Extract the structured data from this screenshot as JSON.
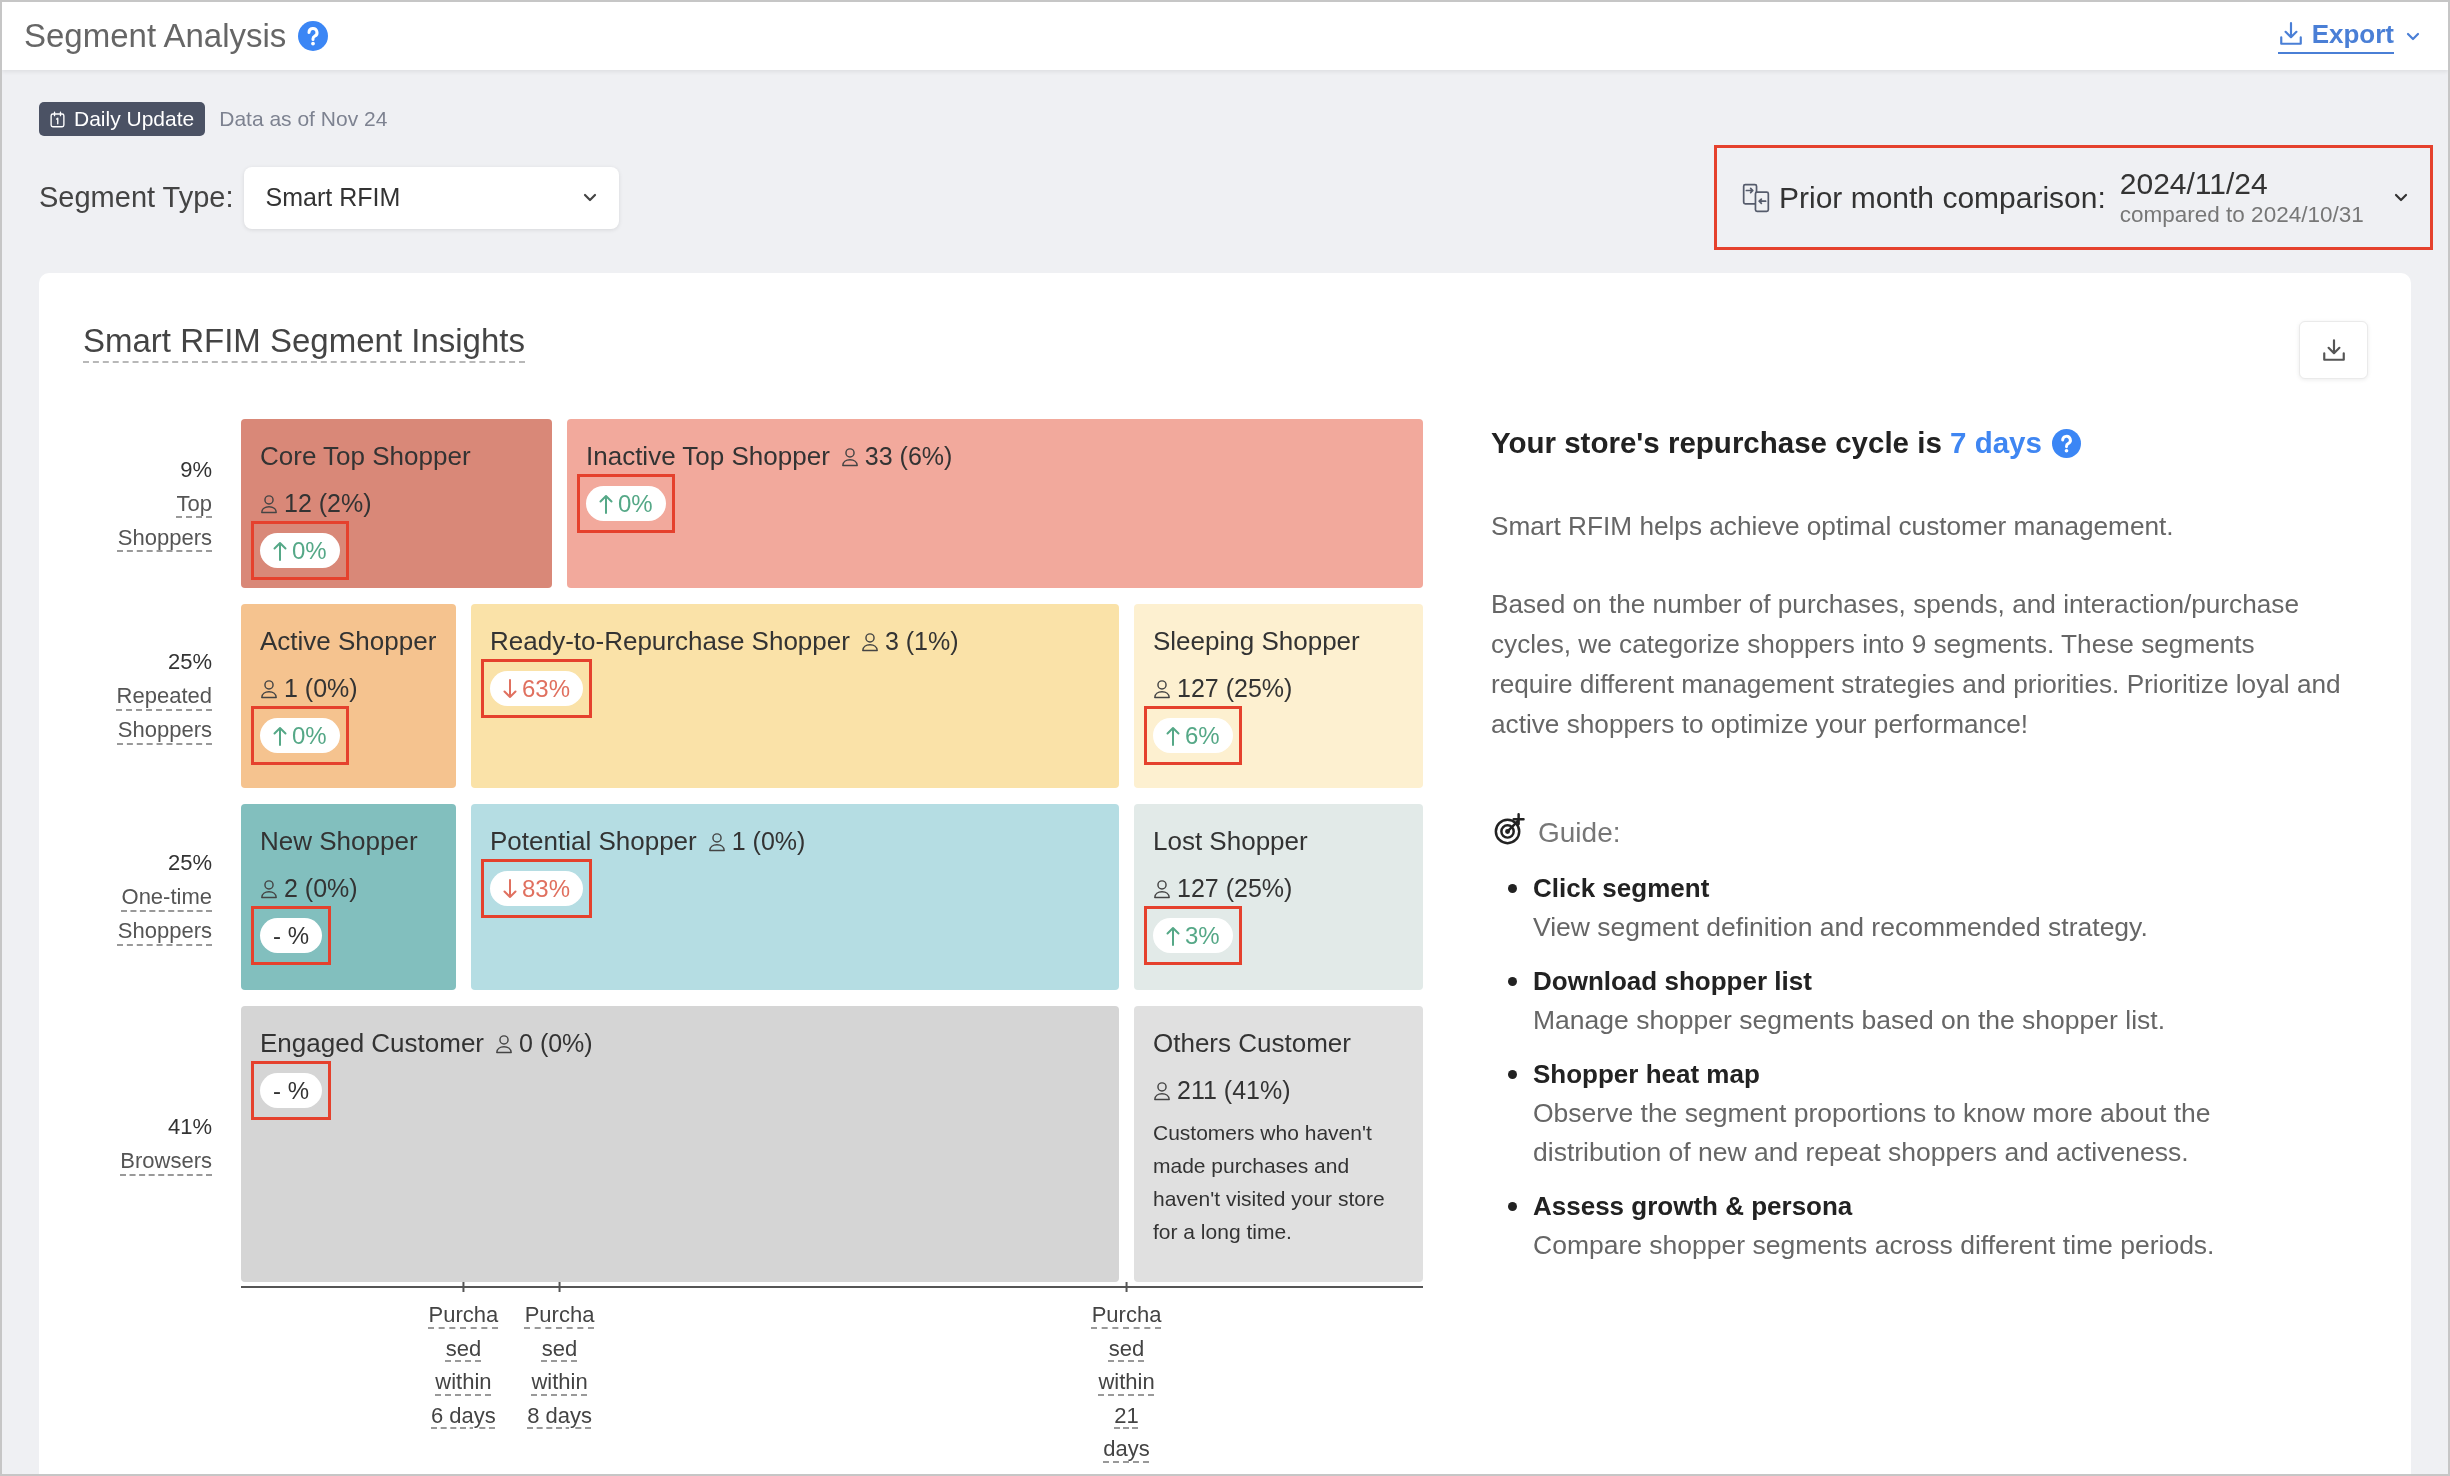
{
  "header": {
    "title": "Segment Analysis",
    "export_label": "Export"
  },
  "update": {
    "badge": "Daily Update",
    "note": "Data as of Nov 24"
  },
  "segment_type": {
    "label": "Segment Type:",
    "value": "Smart RFIM"
  },
  "comparison": {
    "label": "Prior month comparison:",
    "date": "2024/11/24",
    "compared_to": "compared to 2024/10/31",
    "highlighted": true
  },
  "insights": {
    "title": "Smart RFIM Segment Insights",
    "rows": [
      {
        "percent": "9%",
        "label": "Top Shoppers",
        "segments": [
          {
            "name": "Core Top Shopper",
            "count": "12 (2%)",
            "change": {
              "kind": "up",
              "value": "0%",
              "highlighted": true
            },
            "color": "#d98878"
          },
          {
            "name": "Inactive Top Shopper",
            "count": "33 (6%)",
            "change": {
              "kind": "up",
              "value": "0%",
              "highlighted": true
            },
            "color": "#f2a99c"
          }
        ]
      },
      {
        "percent": "25%",
        "label": "Repeated Shoppers",
        "segments": [
          {
            "name": "Active Shopper",
            "count": "1 (0%)",
            "change": {
              "kind": "up",
              "value": "0%",
              "highlighted": true
            },
            "color": "#f5c38f"
          },
          {
            "name": "Ready-to-Repurchase Shopper",
            "count": "3 (1%)",
            "change": {
              "kind": "down",
              "value": "63%",
              "highlighted": true
            },
            "color": "#fae2a8"
          },
          {
            "name": "Sleeping Shopper",
            "count": "127 (25%)",
            "change": {
              "kind": "up",
              "value": "6%",
              "highlighted": true
            },
            "color": "#fdf0d0"
          }
        ]
      },
      {
        "percent": "25%",
        "label": "One-time Shoppers",
        "segments": [
          {
            "name": "New Shopper",
            "count": "2 (0%)",
            "change": {
              "kind": "none",
              "value": "- %",
              "highlighted": true
            },
            "color": "#82bfbe"
          },
          {
            "name": "Potential Shopper",
            "count": "1 (0%)",
            "change": {
              "kind": "down",
              "value": "83%",
              "highlighted": true
            },
            "color": "#b5dde3"
          },
          {
            "name": "Lost Shopper",
            "count": "127 (25%)",
            "change": {
              "kind": "up",
              "value": "3%",
              "highlighted": true
            },
            "color": "#e2eae8"
          }
        ]
      },
      {
        "percent": "41%",
        "label": "Browsers",
        "segments": [
          {
            "name": "Engaged Customer",
            "count": "0 (0%)",
            "change": {
              "kind": "none",
              "value": "- %",
              "highlighted": true
            },
            "color": "#d5d5d5"
          },
          {
            "name": "Others Customer",
            "count": "211 (41%)",
            "description": "Customers who haven't made purchases and haven't visited your store for a long time.",
            "color": "#e0e0e0"
          }
        ]
      }
    ],
    "axis_labels": [
      "Purchased within 6 days",
      "Purchased within 8 days",
      "Purchased within 21 days"
    ]
  },
  "panel": {
    "heading": "Your store's repurchase cycle is",
    "cycle": "7 days",
    "intro": "Smart RFIM helps achieve optimal customer management.",
    "description": "Based on the number of purchases, spends, and interaction/purchase cycles, we categorize shoppers into 9 segments. These segments require different management strategies and priorities. Prioritize loyal and active shoppers to optimize your performance!",
    "guide_title": "Guide:",
    "guide": [
      {
        "title": "Click segment",
        "text": "View segment definition and recommended strategy."
      },
      {
        "title": "Download shopper list",
        "text": "Manage shopper segments based on the shopper list."
      },
      {
        "title": "Shopper heat map",
        "text": "Observe the segment proportions to know more about the distribution of new and repeat shoppers and activeness."
      },
      {
        "title": "Assess growth & persona",
        "text": "Compare shopper segments across different time periods."
      }
    ]
  }
}
